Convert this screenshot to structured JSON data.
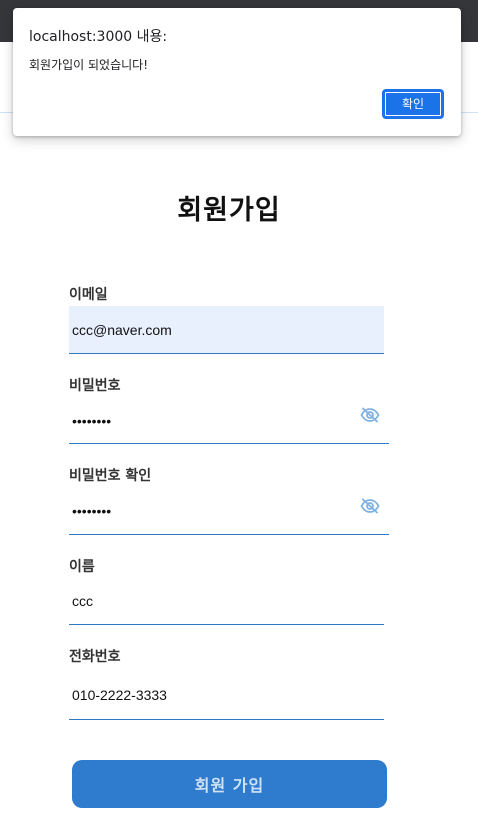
{
  "alert": {
    "title": "localhost:3000 내용:",
    "message": "회원가입이 되었습니다!",
    "ok_label": "확인"
  },
  "page": {
    "title": "회원가입"
  },
  "form": {
    "email": {
      "label": "이메일",
      "value": "ccc@naver.com"
    },
    "password": {
      "label": "비밀번호",
      "value": "pass1234",
      "visibility_icon": "eye-slash-icon"
    },
    "password_confirm": {
      "label": "비밀번호 확인",
      "value": "pass1234",
      "visibility_icon": "eye-slash-icon"
    },
    "name": {
      "label": "이름",
      "value": "ccc"
    },
    "phone": {
      "label": "전화번호",
      "value": "010-2222-3333"
    },
    "submit_label": "회원 가입"
  },
  "colors": {
    "accent": "#2f7bcd",
    "dialog_button": "#1a73e8",
    "autofill_bg": "#e8f0fe",
    "underline": "#2f78c4"
  }
}
